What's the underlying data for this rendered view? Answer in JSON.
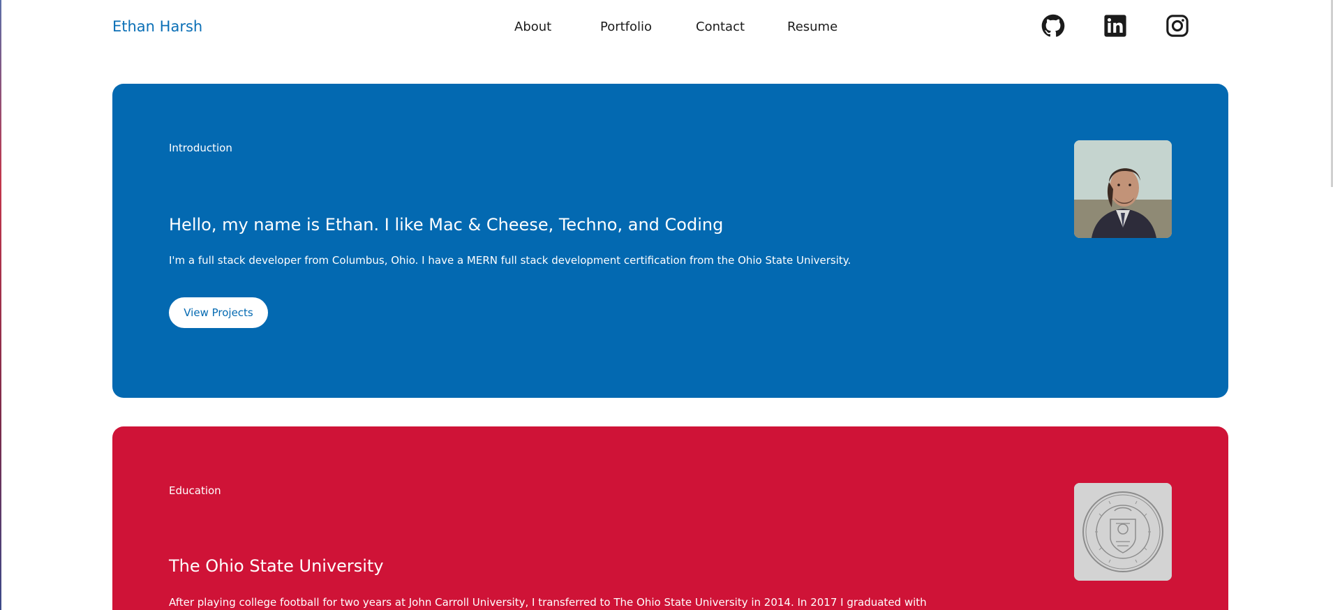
{
  "header": {
    "brand": "Ethan Harsh",
    "nav": {
      "about": "About",
      "portfolio": "Portfolio",
      "contact": "Contact",
      "resume": "Resume"
    },
    "social": [
      {
        "name": "github",
        "icon": "github-icon"
      },
      {
        "name": "linkedin",
        "icon": "linkedin-icon"
      },
      {
        "name": "instagram",
        "icon": "instagram-icon"
      }
    ]
  },
  "intro": {
    "eyebrow": "Introduction",
    "headline": "Hello, my name is Ethan. I like Mac & Cheese, Techno, and Coding",
    "body": "I'm a full stack developer from Columbus, Ohio. I have a MERN full stack development certification from the Ohio State University.",
    "button": "View Projects",
    "image": "profile-photo",
    "color": "#0369b1"
  },
  "education": {
    "eyebrow": "Education",
    "headline": "The Ohio State University",
    "body": "After playing college football for two years at John Carroll University, I transferred to The Ohio State University in 2014. In 2017 I graduated with",
    "image": "ohio-state-seal",
    "color": "#cf1337"
  }
}
